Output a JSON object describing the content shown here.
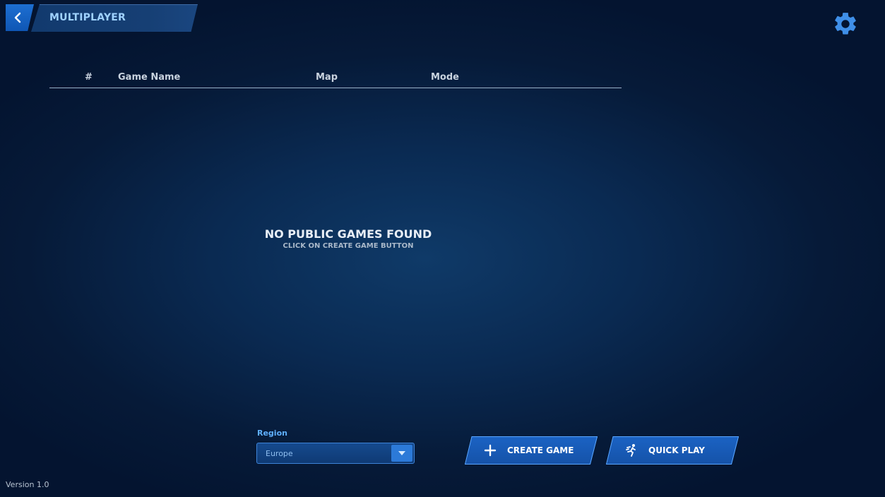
{
  "header": {
    "title": "MULTIPLAYER"
  },
  "table": {
    "columns": [
      "#",
      "Game Name",
      "Map",
      "Mode"
    ]
  },
  "empty_state": {
    "title": "NO PUBLIC GAMES FOUND",
    "subtitle": "CLICK ON CREATE GAME BUTTON"
  },
  "region": {
    "label": "Region",
    "selected": "Europe"
  },
  "actions": {
    "create_label": "CREATE GAME",
    "quick_label": "QUICK PLAY"
  },
  "footer": {
    "version": "Version 1.0"
  },
  "colors": {
    "accent": "#1d6fd2",
    "label_blue": "#5fb0ff",
    "background": "#0a2a52"
  },
  "icons": [
    "back-arrow-icon",
    "gear-icon",
    "chevron-down-icon",
    "plus-icon",
    "running-figure-icon"
  ]
}
